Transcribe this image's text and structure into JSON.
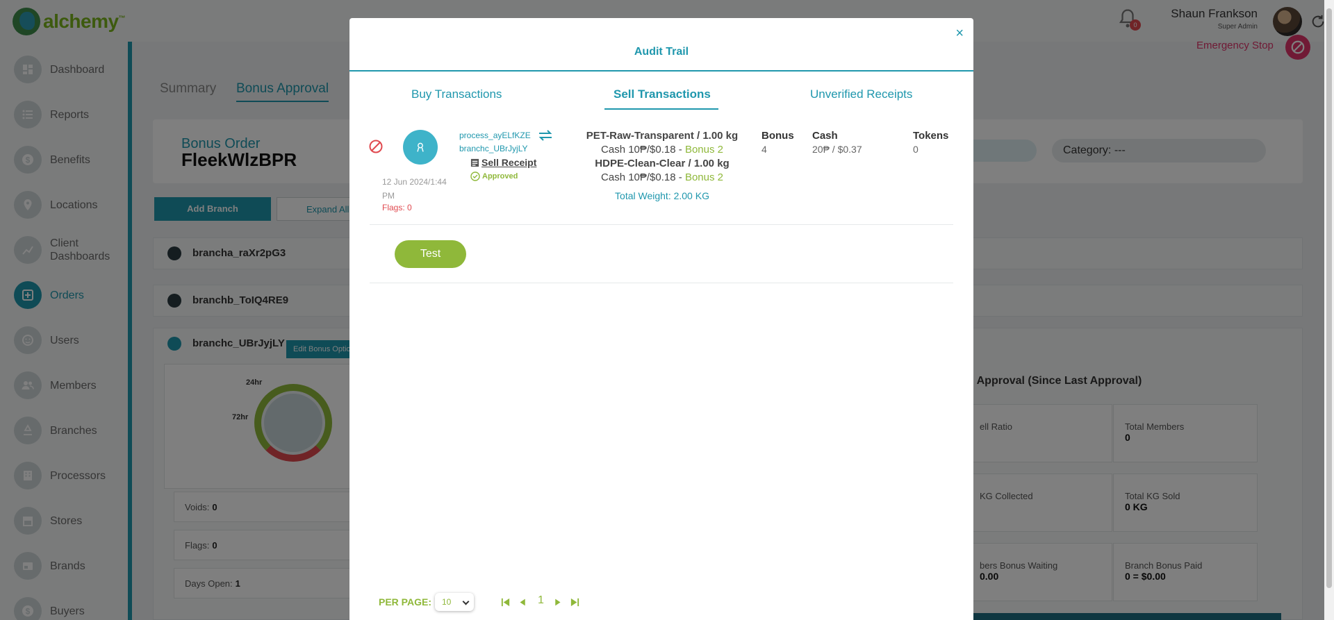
{
  "app": {
    "logo_text": "alchemy",
    "logo_tm": "™"
  },
  "header": {
    "notification_count": "0",
    "user_name": "Shaun Frankson",
    "user_role": "Super Admin"
  },
  "sidebar": {
    "items": [
      {
        "label": "Dashboard",
        "icon": "dashboard-icon"
      },
      {
        "label": "Reports",
        "icon": "list-icon"
      },
      {
        "label": "Benefits",
        "icon": "dollar-icon"
      },
      {
        "label": "Locations",
        "icon": "map-pin-icon"
      },
      {
        "label": "Client Dashboards",
        "icon": "chart-icon"
      },
      {
        "label": "Orders",
        "icon": "orders-icon",
        "active": true
      },
      {
        "label": "Users",
        "icon": "user-face-icon"
      },
      {
        "label": "Members",
        "icon": "members-icon"
      },
      {
        "label": "Branches",
        "icon": "recycle-icon"
      },
      {
        "label": "Processors",
        "icon": "building-icon"
      },
      {
        "label": "Stores",
        "icon": "store-icon"
      },
      {
        "label": "Brands",
        "icon": "brand-icon"
      },
      {
        "label": "Buyers",
        "icon": "buyer-icon"
      }
    ]
  },
  "main": {
    "emergency_stop": "Emergency Stop",
    "tabs": [
      "Summary",
      "Bonus Approval"
    ],
    "order_label": "Bonus Order",
    "order_id": "FleekWlzBPR",
    "category": "Category: ---",
    "add_branch": "Add Branch",
    "expand_all": "Expand All",
    "branches": [
      "brancha_raXr2pG3",
      "branchb_ToIQ4RE9",
      "branchc_UBrJyjLY"
    ],
    "edit_bonus": "Edit Bonus Optio",
    "gauge": {
      "label_24": "24hr",
      "label_72": "72hr",
      "value": "0"
    },
    "stats": [
      {
        "label": "Voids:",
        "value": "0"
      },
      {
        "label": "Flags:",
        "value": "0"
      },
      {
        "label": "Days Open:",
        "value": "1"
      }
    ],
    "approval_title": "g Approval (Since Last Approval)",
    "metrics": [
      {
        "label": "ell Ratio",
        "value": ""
      },
      {
        "label": "Total Members",
        "value": "0"
      },
      {
        "label": "KG Collected",
        "value": ""
      },
      {
        "label": "Total KG Sold",
        "value": "0 KG"
      },
      {
        "label": "bers Bonus Waiting",
        "value": "0.00"
      },
      {
        "label": "Branch Bonus Paid",
        "value": "0 = $0.00"
      }
    ]
  },
  "modal": {
    "title": "Audit Trail",
    "close": "×",
    "tabs": [
      {
        "label": "Buy Transactions"
      },
      {
        "label": "Sell Transactions",
        "active": true
      },
      {
        "label": "Unverified Receipts"
      }
    ],
    "transaction": {
      "date": "12 Jun 2024/1:44 PM",
      "flags": "Flags: 0",
      "process": "process_ayELfKZE",
      "branch": "branchc_UBrJyjLY",
      "receipt": "Sell Receipt",
      "status": "Approved",
      "items": [
        {
          "name": "PET-Raw-Transparent / 1.00 kg",
          "price": "Cash 10₱/$0.18 - ",
          "bonus": "Bonus 2"
        },
        {
          "name": "HDPE-Clean-Clear / 1.00 kg",
          "price": "Cash 10₱/$0.18 - ",
          "bonus": "Bonus 2"
        }
      ],
      "total_weight": "Total Weight: 2.00 KG",
      "columns": [
        {
          "header": "Bonus",
          "value": "4"
        },
        {
          "header": "Cash",
          "value": "20₱ / $0.37"
        },
        {
          "header": "Tokens",
          "value": "0"
        }
      ]
    },
    "test_button": "Test",
    "pagination": {
      "per_page_label": "PER PAGE:",
      "per_page_value": "10",
      "current_page": "1"
    }
  },
  "colors": {
    "teal": "#1f97ad",
    "green": "#8fb83a",
    "red": "#e0494f",
    "pink": "#e0346a"
  }
}
